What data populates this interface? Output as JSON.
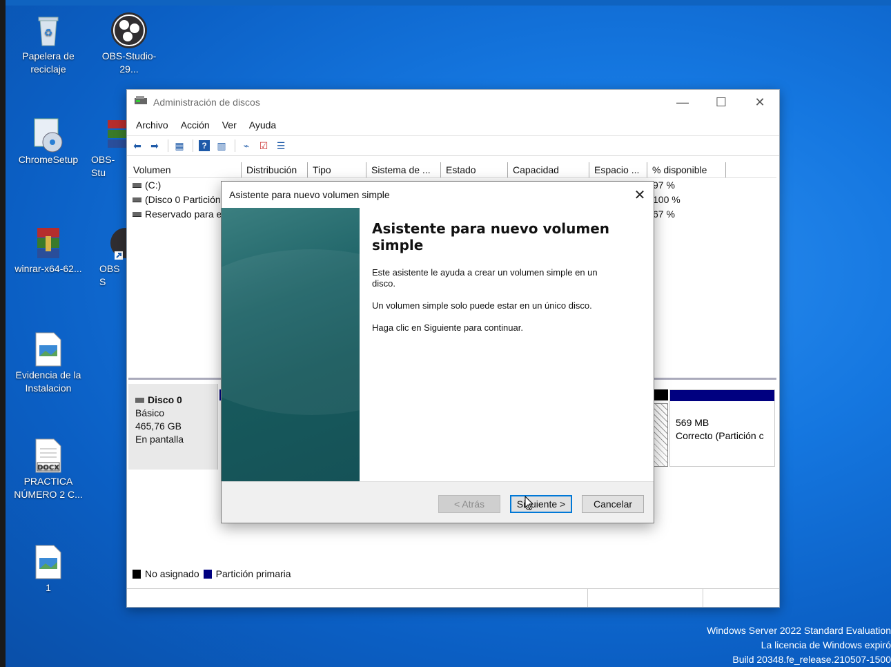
{
  "desktop": {
    "icons": [
      {
        "label": "Papelera de reciclaje",
        "icon": "recycle-bin-icon"
      },
      {
        "label": "OBS-Studio-29...",
        "icon": "obs-icon"
      },
      {
        "label": "ChromeSetup",
        "icon": "installer-icon"
      },
      {
        "label": "OBS-Stu",
        "icon": "winrar-archive-icon"
      },
      {
        "label": "winrar-x64-62...",
        "icon": "winrar-icon"
      },
      {
        "label": "OBS S",
        "icon": "obs-shortcut-icon"
      },
      {
        "label": "Evidencia de la Instalacion",
        "icon": "image-file-icon"
      },
      {
        "label": "PRACTICA NÚMERO 2 C...",
        "icon": "docx-file-icon"
      },
      {
        "label": "1",
        "icon": "image-file-icon"
      }
    ]
  },
  "window": {
    "title": "Administración de discos",
    "menu": [
      "Archivo",
      "Acción",
      "Ver",
      "Ayuda"
    ],
    "columns": [
      "Volumen",
      "Distribución",
      "Tipo",
      "Sistema de ...",
      "Estado",
      "Capacidad",
      "Espacio ...",
      "% disponible"
    ],
    "rows": [
      {
        "volume": "(C:)",
        "available": "97 %"
      },
      {
        "volume": "(Disco 0 Partición",
        "available": "100 %"
      },
      {
        "volume": "Reservado para e",
        "available": "67 %"
      }
    ],
    "disk": {
      "name": "Disco 0",
      "type": "Básico",
      "size": "465,76 GB",
      "status": "En pantalla"
    },
    "partition": {
      "size": "569 MB",
      "status": "Correcto (Partición c"
    },
    "legend": {
      "unallocated": "No asignado",
      "primary": "Partición primaria"
    },
    "colors": {
      "unallocated": "#000000",
      "primary": "#000080"
    }
  },
  "wizard": {
    "title": "Asistente para nuevo volumen simple",
    "heading": "Asistente para nuevo volumen simple",
    "p1": "Este asistente le ayuda a crear un volumen simple en un disco.",
    "p2": "Un volumen simple solo puede estar en un único disco.",
    "p3": "Haga clic en Siguiente para continuar.",
    "back": "< Atrás",
    "next": "Siguiente >",
    "cancel": "Cancelar"
  },
  "watermark": {
    "line1": "Windows Server 2022 Standard Evaluation",
    "line2": "La licencia de Windows expiró",
    "line3": "Build 20348.fe_release.210507-1500"
  }
}
